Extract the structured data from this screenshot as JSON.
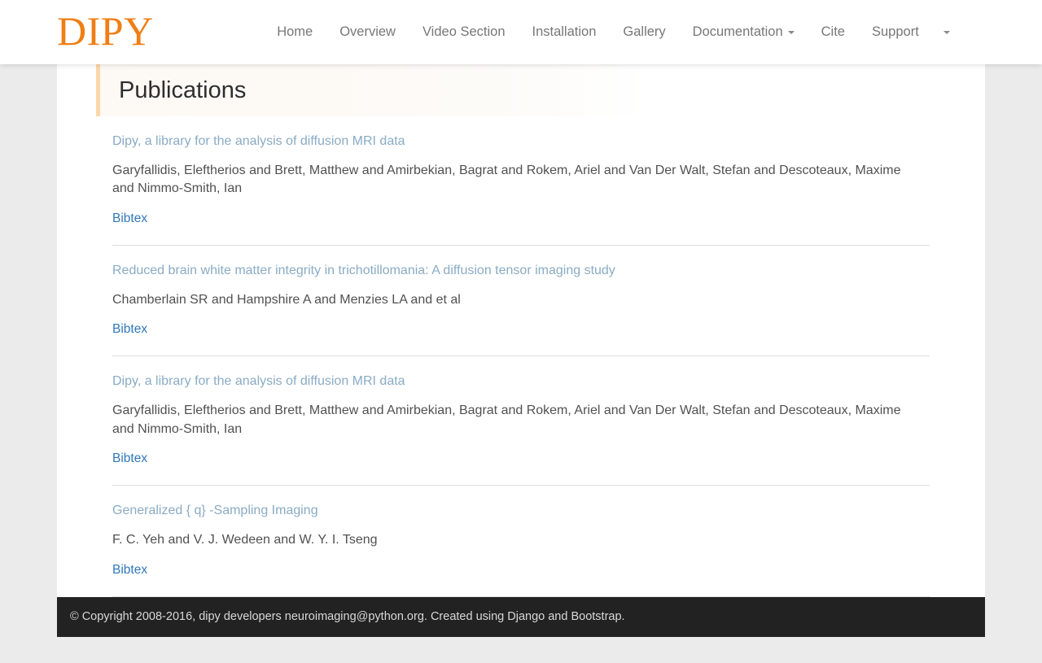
{
  "navbar": {
    "brand": "DIPY",
    "items": [
      {
        "label": "Home",
        "has_caret": false
      },
      {
        "label": "Overview",
        "has_caret": false
      },
      {
        "label": "Video Section",
        "has_caret": false
      },
      {
        "label": "Installation",
        "has_caret": false
      },
      {
        "label": "Gallery",
        "has_caret": false
      },
      {
        "label": "Documentation",
        "has_caret": true
      },
      {
        "label": "Cite",
        "has_caret": false
      },
      {
        "label": "Support",
        "has_caret": false
      }
    ],
    "trailing_toggle_icon": "chevron-down-icon"
  },
  "header": {
    "title": "Publications",
    "accent_color": "#fad7a8"
  },
  "publications": [
    {
      "title": "Dipy, a library for the analysis of diffusion MRI data",
      "authors": "Garyfallidis, Eleftherios and Brett, Matthew and Amirbekian, Bagrat and Rokem, Ariel and Van Der Walt, Stefan and Descoteaux, Maxime and Nimmo-Smith, Ian",
      "bibtex_label": "Bibtex"
    },
    {
      "title": "Reduced brain white matter integrity in trichotillomania: A diffusion tensor imaging study",
      "authors": "Chamberlain SR and Hampshire A and Menzies LA and et al",
      "bibtex_label": "Bibtex"
    },
    {
      "title": "Dipy, a library for the analysis of diffusion MRI data",
      "authors": "Garyfallidis, Eleftherios and Brett, Matthew and Amirbekian, Bagrat and Rokem, Ariel and Van Der Walt, Stefan and Descoteaux, Maxime and Nimmo-Smith, Ian",
      "bibtex_label": "Bibtex"
    },
    {
      "title": "Generalized { q} -Sampling Imaging",
      "authors": "F. C. Yeh and V. J. Wedeen and W. Y. I. Tseng",
      "bibtex_label": "Bibtex"
    }
  ],
  "footer": {
    "text": "© Copyright 2008-2016, dipy developers neuroimaging@python.org. Created using Django and Bootstrap."
  },
  "colors": {
    "brand_orange": "#f07e14",
    "link_blue": "#3277b8",
    "title_blue": "#8aabc4",
    "page_background": "#ebebeb",
    "footer_background": "#222222"
  }
}
